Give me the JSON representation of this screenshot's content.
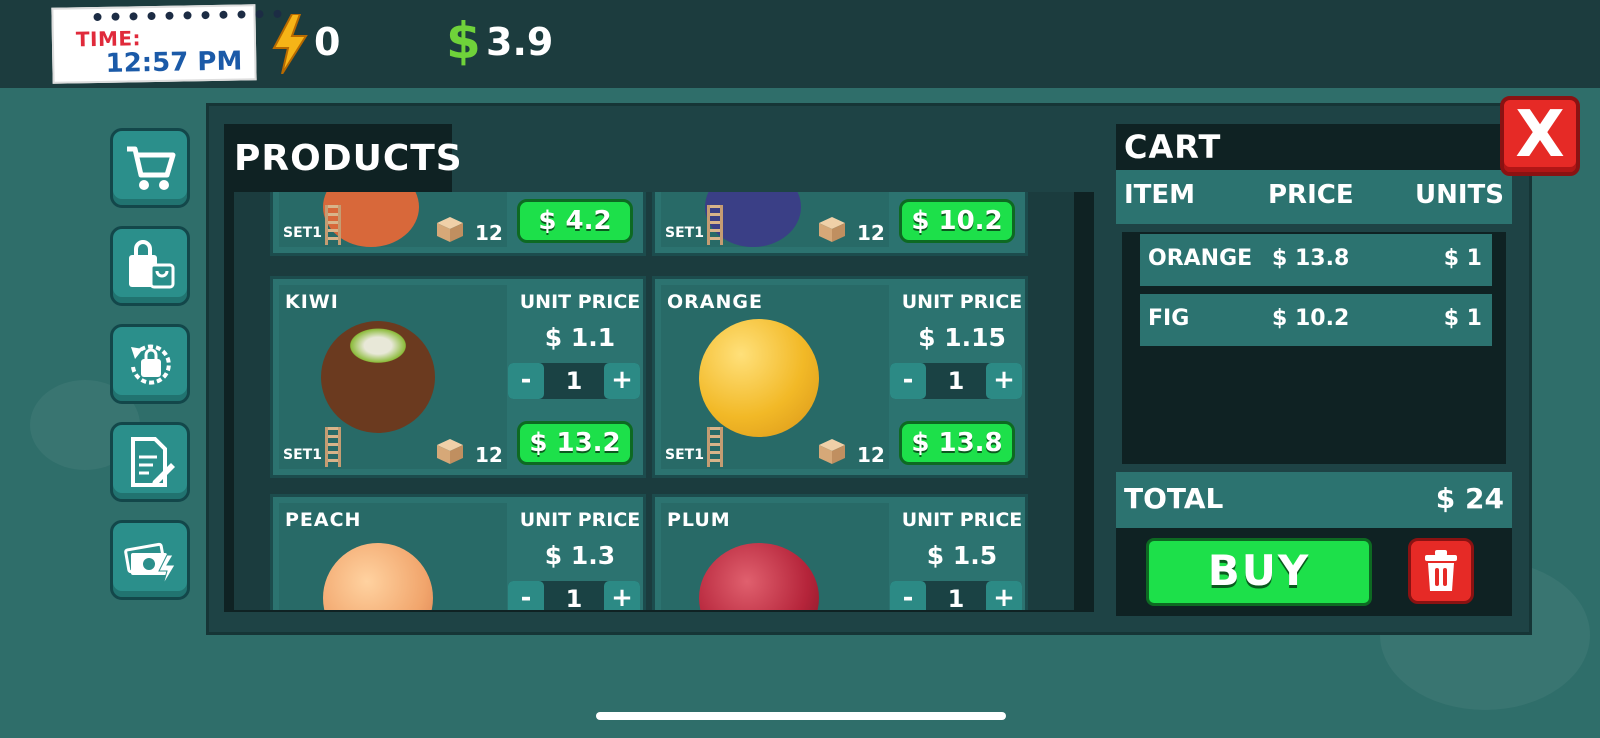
{
  "hud": {
    "time_label": "TIME:",
    "time_value": "12:57 PM",
    "energy_value": "0",
    "money_symbol": "$",
    "money_value": "3.9"
  },
  "sidebar": [
    {
      "icon": "cart-icon"
    },
    {
      "icon": "shopping-bags-icon"
    },
    {
      "icon": "restock-bag-icon"
    },
    {
      "icon": "document-edit-icon"
    },
    {
      "icon": "cash-energy-icon"
    }
  ],
  "products": {
    "title": "PRODUCTS",
    "top_partial": [
      {
        "set": "SET1",
        "stock": "12",
        "buy_price": "$ 4.2",
        "fruit_color": "#d8683a"
      },
      {
        "set": "SET1",
        "stock": "12",
        "buy_price": "$ 10.2",
        "fruit_color": "#3a3f86"
      }
    ],
    "items": [
      {
        "name": "KIWI",
        "unit_label": "UNIT PRICE",
        "unit_price": "$ 1.1",
        "qty": "1",
        "set": "SET1",
        "stock": "12",
        "buy_price": "$ 13.2",
        "fruit_color": "#7a3d24"
      },
      {
        "name": "ORANGE",
        "unit_label": "UNIT PRICE",
        "unit_price": "$ 1.15",
        "qty": "1",
        "set": "SET1",
        "stock": "12",
        "buy_price": "$ 13.8",
        "fruit_color": "#f2b927"
      },
      {
        "name": "PEACH",
        "unit_label": "UNIT PRICE",
        "unit_price": "$ 1.3",
        "qty": "1",
        "fruit_color": "#f1a56c"
      },
      {
        "name": "PLUM",
        "unit_label": "UNIT PRICE",
        "unit_price": "$ 1.5",
        "qty": "1",
        "fruit_color": "#b5243a"
      }
    ],
    "minus": "-",
    "plus": "+"
  },
  "cart": {
    "title": "CART",
    "col_item": "ITEM",
    "col_price": "PRICE",
    "col_units": "UNITS",
    "rows": [
      {
        "item": "ORANGE",
        "price": "$ 13.8",
        "units": "$ 1"
      },
      {
        "item": "FIG",
        "price": "$ 10.2",
        "units": "$ 1"
      }
    ],
    "total_label": "TOTAL",
    "total_value": "$ 24",
    "buy_label": "BUY"
  },
  "close_label": "X",
  "colors": {
    "accent_green": "#1de04a",
    "danger_red": "#e62a26",
    "panel_teal": "#2c7370"
  }
}
